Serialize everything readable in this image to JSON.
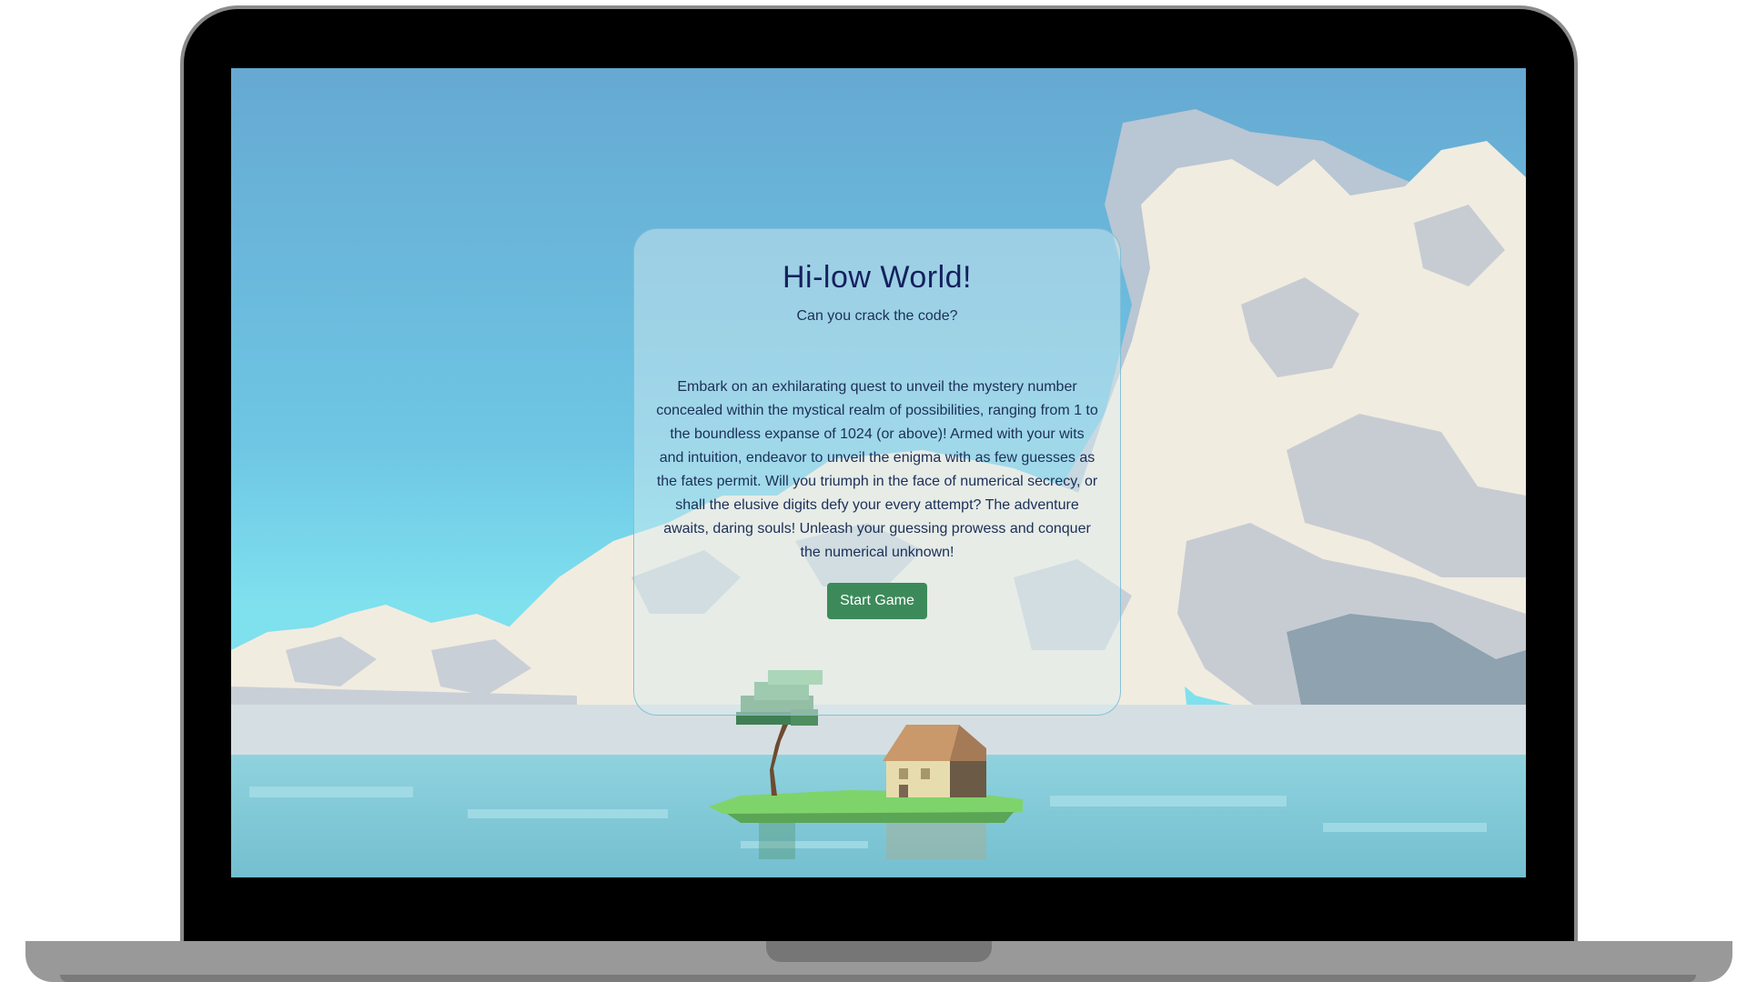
{
  "card": {
    "title": "Hi-low World!",
    "subtitle": "Can you crack the code?",
    "description": "Embark on an exhilarating quest to unveil the mystery number concealed within the mystical realm of possibilities, ranging from 1 to the boundless expanse of 1024 (or above)! Armed with your wits and intuition, endeavor to unveil the enigma with as few guesses as the fates permit. Will you triumph in the face of numerical secrecy, or shall the elusive digits defy your every attempt? The adventure awaits, daring souls! Unleash your guessing prowess and conquer the numerical unknown!",
    "start_button_label": "Start Game"
  },
  "colors": {
    "sky_top": "#66add4",
    "sky_bottom": "#7fe0ee",
    "cloud_cream": "#f1ece0",
    "cloud_grey": "#c6cbd2",
    "water": "#8fcfdc",
    "button_green": "#3c8a5a",
    "title_navy": "#14215e"
  },
  "icons": {
    "scene": "pixel-art-island-icon"
  }
}
